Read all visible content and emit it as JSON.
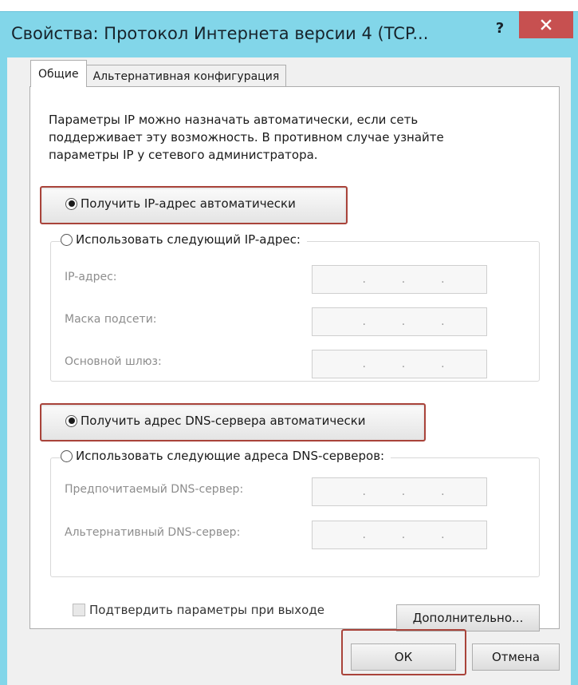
{
  "window": {
    "title": "Свойства: Протокол Интернета версии 4 (TCP...",
    "help_label": "?",
    "close_icon": "close-icon"
  },
  "tabs": [
    {
      "label": "Общие",
      "active": true
    },
    {
      "label": "Альтернативная конфигурация",
      "active": false
    }
  ],
  "general": {
    "intro_line1": "Параметры IP можно назначать автоматически, если сеть",
    "intro_line2": "поддерживает эту возможность. В противном случае узнайте",
    "intro_line3": "параметры IP у сетевого администратора.",
    "ip_auto_label": "Получить IP-адрес автоматически",
    "ip_manual_label": "Использовать следующий IP-адрес:",
    "ip_address_label": "IP-адрес:",
    "subnet_label": "Маска подсети:",
    "gateway_label": "Основной шлюз:",
    "dns_auto_label": "Получить адрес DNS-сервера автоматически",
    "dns_manual_label": "Использовать следующие адреса DNS-серверов:",
    "dns_preferred_label": "Предпочитаемый DNS-сервер:",
    "dns_alternate_label": "Альтернативный DNS-сервер:",
    "ip_auto_selected": true,
    "dns_auto_selected": true,
    "ip_separator": "."
  },
  "validate": {
    "label": "Подтвердить параметры при выходе",
    "checked": false
  },
  "buttons": {
    "advanced": "Дополнительно...",
    "ok": "ОК",
    "cancel": "Отмена"
  },
  "colors": {
    "frame": "#82d6e9",
    "close": "#c75050",
    "highlight": "#a9433a"
  }
}
